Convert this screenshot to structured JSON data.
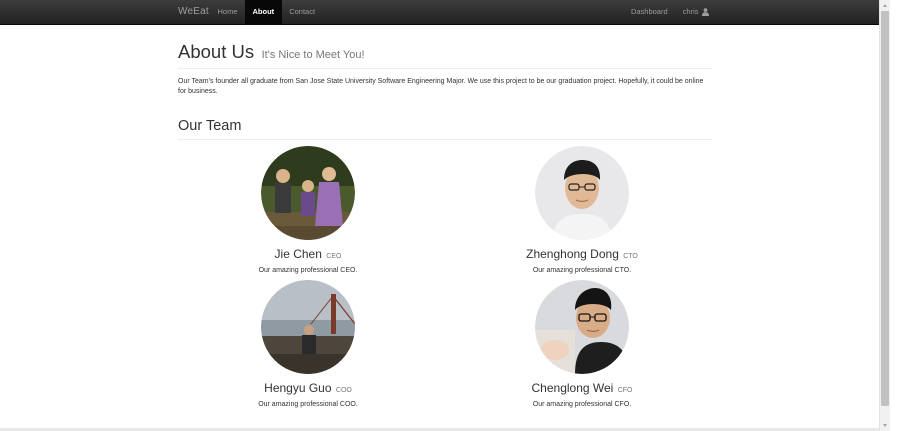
{
  "navbar": {
    "brand": "WeEat",
    "links": [
      {
        "label": "Home",
        "active": false
      },
      {
        "label": "About",
        "active": true
      },
      {
        "label": "Contact",
        "active": false
      }
    ],
    "dashboard": "Dashboard",
    "user": "chris"
  },
  "header": {
    "title": "About Us",
    "subtitle": "It's Nice to Meet You!"
  },
  "intro": "Our Team's founder all graduate from San Jose State University Software Engineering Major. We use this project to be our graduation project. Hopefully, it could be online for business.",
  "team": {
    "title": "Our Team",
    "members": [
      {
        "name": "Jie Chen",
        "role": "CEO",
        "desc": "Our amazing professional CEO."
      },
      {
        "name": "Zhenghong Dong",
        "role": "CTO",
        "desc": "Our amazing professional CTO."
      },
      {
        "name": "Hengyu Guo",
        "role": "COO",
        "desc": "Our amazing professional COO."
      },
      {
        "name": "Chenglong Wei",
        "role": "CFO",
        "desc": "Our amazing professional CFO."
      }
    ]
  },
  "colors": {
    "navbar_bg": "#222222",
    "nav_text": "#9d9d9d",
    "active_bg": "#080808",
    "muted": "#777777"
  },
  "icons": {
    "user": "user-icon"
  }
}
